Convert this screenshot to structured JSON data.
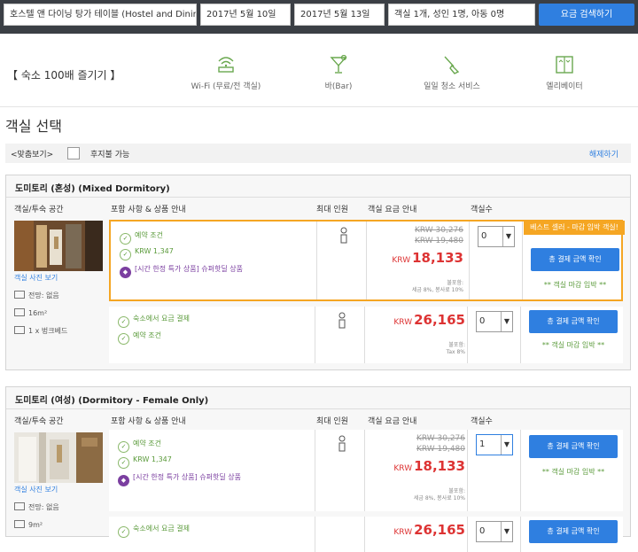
{
  "search": {
    "hotel": "호스텔 앤 다이닝 탕가 테이블 (Hostel and Dining Tangatable)",
    "checkin": "2017년 5월 10일",
    "checkout": "2017년 5월 13일",
    "guests": "객실 1개, 성인 1명, 아동 0명",
    "button": "요금 검색하기"
  },
  "amenities": {
    "title": "【 숙소 100배 즐기기 】",
    "items": [
      {
        "label": "Wi-Fi (무료/전 객실)",
        "icon": "wifi-icon"
      },
      {
        "label": "바(Bar)",
        "icon": "cocktail-icon"
      },
      {
        "label": "일일 청소 서비스",
        "icon": "broom-icon"
      },
      {
        "label": "엘리베이터",
        "icon": "elevator-icon"
      }
    ]
  },
  "section_title": "객실 선택",
  "filter": {
    "label": "<맞춤보기>",
    "checkbox_label": "후지불 가능",
    "reset": "해제하기"
  },
  "columns": {
    "room": "객실/투숙 공간",
    "includes": "포함 사항 & 상품 안내",
    "max": "최대 인원",
    "price": "객실 요금 안내",
    "count": "객실수"
  },
  "rooms": [
    {
      "title": "도미토리 (혼성) (Mixed Dormitory)",
      "photo_link": "객실 사진 보기",
      "specs": [
        "전망: 없음",
        "16m²",
        "1 x 벙크베드"
      ],
      "options": [
        {
          "badge": "베스트 셀러 - 마감 임박 객실!",
          "inclusions": [
            "예약 조건",
            "KRW 1,347",
            "[시간 한정 특가 상품] 슈퍼핫딜 상품"
          ],
          "old_prices": [
            "KRW 30,276",
            "KRW 19,480"
          ],
          "currency": "KRW",
          "price": "18,133",
          "tax_lines": [
            "불포함:",
            "세금 8%, 봉사료 10%"
          ],
          "qty": "0",
          "button": "총 결제 금액 확인",
          "urgent": "** 객실 마감 임박 **"
        },
        {
          "inclusions": [
            "숙소에서 요금 결제",
            "예약 조건"
          ],
          "currency": "KRW",
          "price": "26,165",
          "tax_lines": [
            "불포함:",
            "Tax 8%"
          ],
          "qty": "0",
          "button": "총 결제 금액 확인",
          "urgent": "** 객실 마감 임박 **"
        }
      ]
    },
    {
      "title": "도미토리 (여성) (Dormitory - Female Only)",
      "photo_link": "객실 사진 보기",
      "specs": [
        "전망: 없음",
        "9m²"
      ],
      "options": [
        {
          "inclusions": [
            "예약 조건",
            "KRW 1,347",
            "[시간 한정 특가 상품] 슈퍼핫딜 상품"
          ],
          "old_prices": [
            "KRW 30,276",
            "KRW 19,480"
          ],
          "currency": "KRW",
          "price": "18,133",
          "tax_lines": [
            "불포함:",
            "세금 8%, 봉사료 10%"
          ],
          "qty": "1",
          "button": "총 결제 금액 확인",
          "urgent": "** 객실 마감 임박 **"
        },
        {
          "inclusions": [
            "숙소에서 요금 결제"
          ],
          "currency": "KRW",
          "price": "26,165",
          "qty": "0",
          "button": "총 결제 금액 확인"
        }
      ]
    }
  ],
  "colors": {
    "accent": "#2f7fe0",
    "price": "#d33333",
    "best": "#f5a623",
    "green": "#5a9a3a",
    "promo": "#7b3fa0"
  }
}
